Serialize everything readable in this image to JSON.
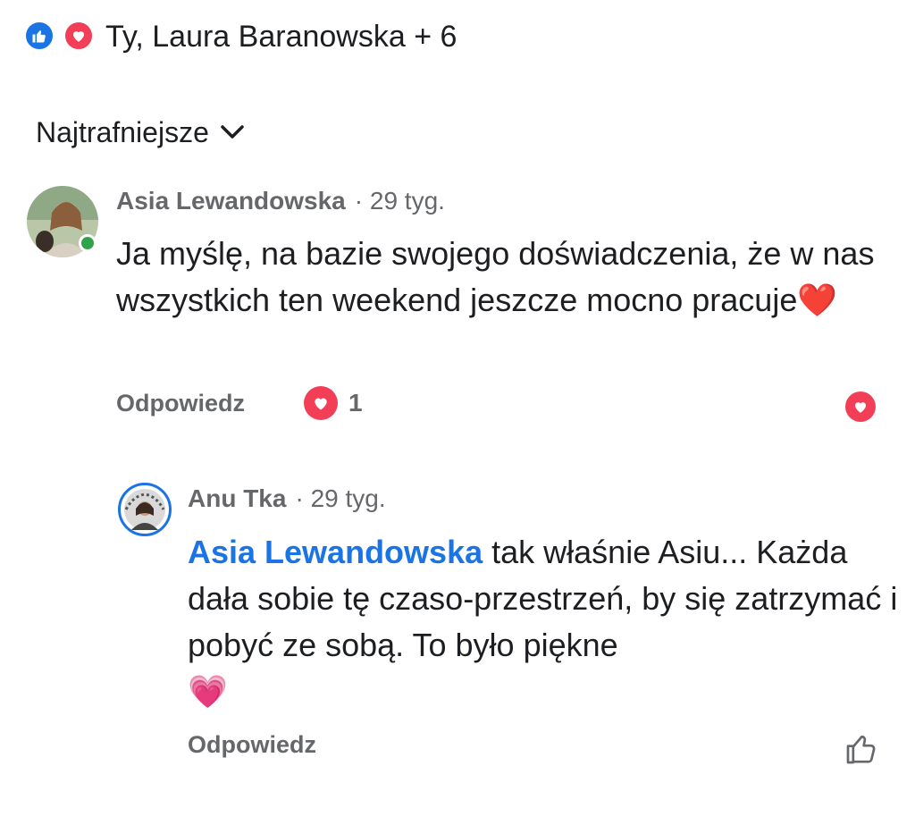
{
  "reactions": {
    "icons": [
      "like-icon",
      "love-icon"
    ],
    "summary": "Ty, Laura Baranowska + 6",
    "colors": {
      "like": "#1b74e4",
      "love": "#f33e58"
    }
  },
  "sort": {
    "label": "Najtrafniejsze",
    "icon": "chevron-down-icon"
  },
  "comments": [
    {
      "author": "Asia Lewandowska",
      "time": "· 29 tyg.",
      "text": "Ja myślę, na bazie swojego doświadczenia, że w nas wszystkich ten weekend jeszcze mocno pracuje",
      "emoji": "❤️",
      "online": true,
      "reply_label": "Odpowiedz",
      "reaction_icon": "love-icon",
      "reaction_count": "1",
      "react_button_icon": "love-icon"
    },
    {
      "author": "Anu Tka",
      "time": "· 29 tyg.",
      "mention": "Asia Lewandowska",
      "text": " tak właśnie Asiu... Każda dała sobie tę czaso-przestrzeń, by się zatrzymać i pobyć ze sobą. To było piękne",
      "emoji": "💗",
      "reply_label": "Odpowiedz",
      "react_button_icon": "thumbs-up-outline-icon"
    }
  ]
}
